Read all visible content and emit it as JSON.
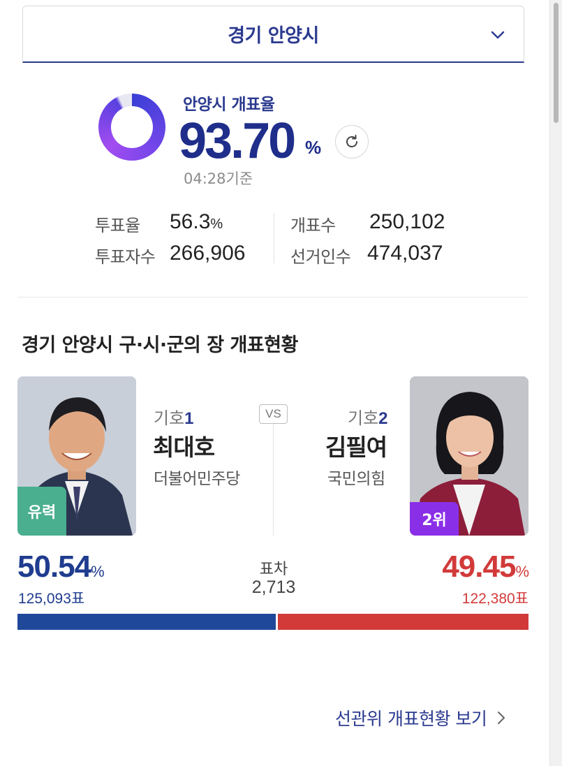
{
  "region_selector": {
    "name": "경기 안양시"
  },
  "count_status": {
    "label": "안양시 개표율",
    "rate": "93.70",
    "rate_unit": "%",
    "rate_percent": 93.7,
    "updated": "04:28기준"
  },
  "stats": [
    {
      "label": "투표율",
      "value": "56.3",
      "unit": "%"
    },
    {
      "label": "투표자수",
      "value": "266,906",
      "unit": ""
    },
    {
      "label": "개표수",
      "value": "250,102",
      "unit": ""
    },
    {
      "label": "선거인수",
      "value": "474,037",
      "unit": ""
    }
  ],
  "section_title": "경기 안양시 구·시·군의 장 개표현황",
  "vs_label": "VS",
  "candidates": [
    {
      "number_prefix": "기호",
      "number": "1",
      "name": "최대호",
      "party": "더불어민주당",
      "badge": "유력",
      "percent": "50.54",
      "percent_value": 50.54,
      "unit": "%",
      "votes": "125,093표",
      "color": "#20489a"
    },
    {
      "number_prefix": "기호",
      "number": "2",
      "name": "김필여",
      "party": "국민의힘",
      "badge": "2위",
      "percent": "49.45",
      "percent_value": 49.45,
      "unit": "%",
      "votes": "122,380표",
      "color": "#d23a3a"
    }
  ],
  "margin": {
    "label": "표차",
    "value": "2,713"
  },
  "footer_link": {
    "label": "선관위 개표현황 보기"
  },
  "icons": {
    "dropdown": "chevron-down-icon",
    "refresh": "refresh-icon",
    "link": "chevron-right-icon"
  }
}
